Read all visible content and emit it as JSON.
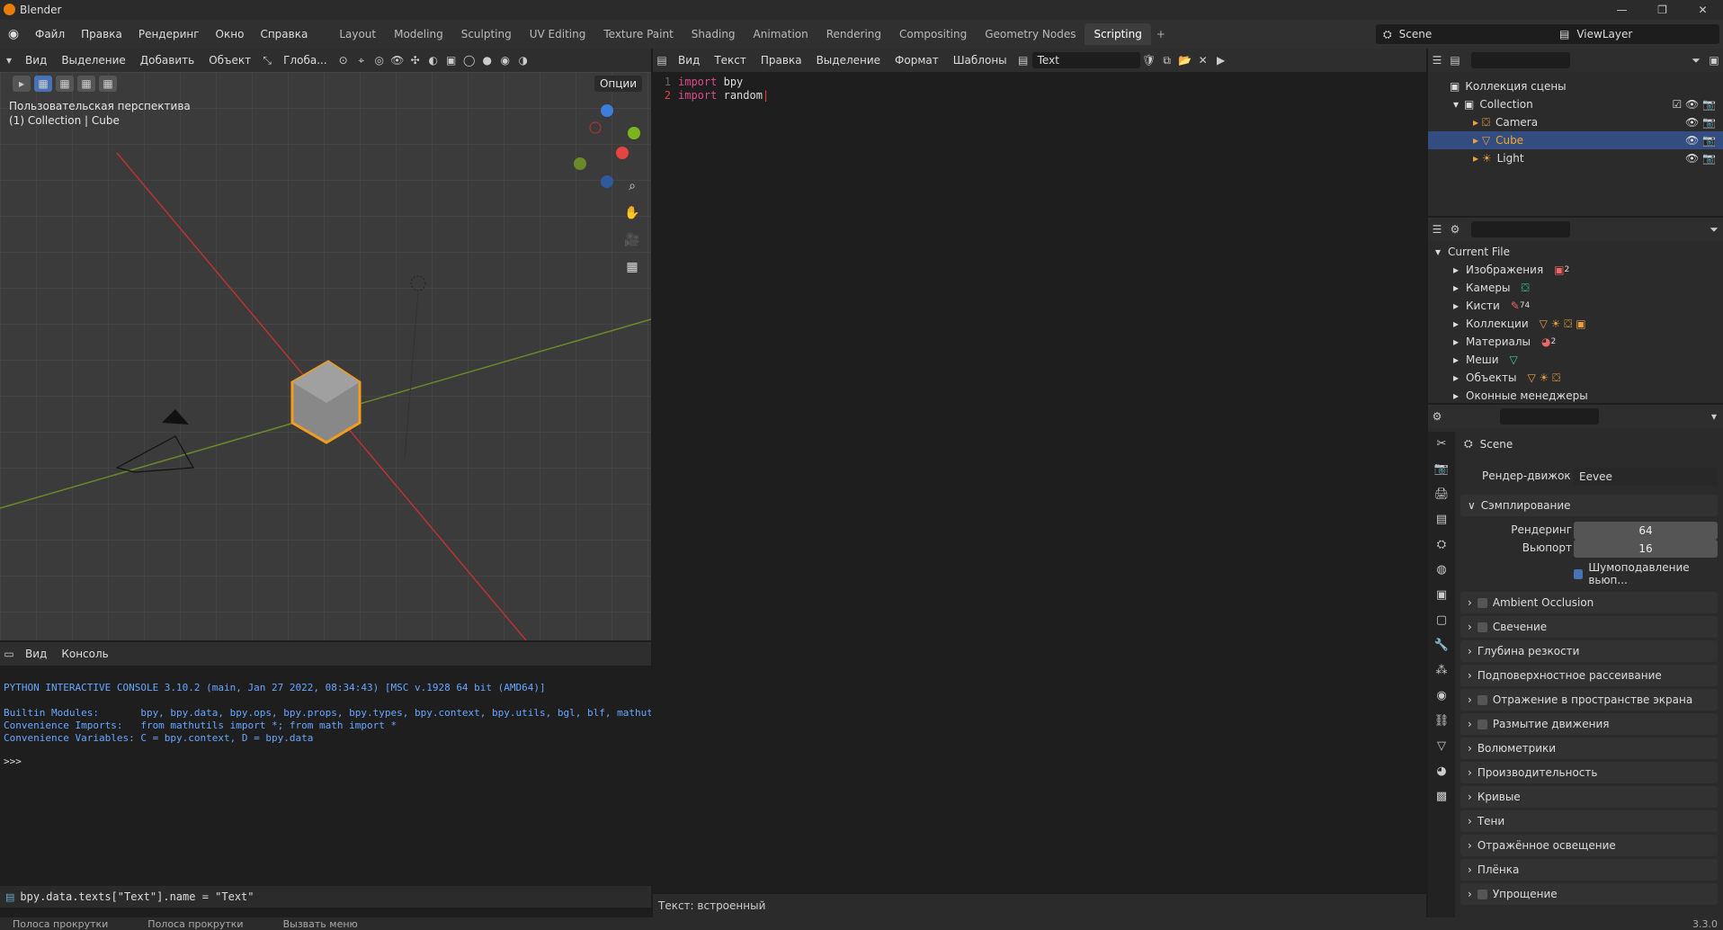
{
  "window": {
    "title": "Blender"
  },
  "menu": [
    "Файл",
    "Правка",
    "Рендеринг",
    "Окно",
    "Справка"
  ],
  "workspaces": [
    "Layout",
    "Modeling",
    "Sculpting",
    "UV Editing",
    "Texture Paint",
    "Shading",
    "Animation",
    "Rendering",
    "Compositing",
    "Geometry Nodes",
    "Scripting"
  ],
  "active_workspace": "Scripting",
  "scene": {
    "label": "Scene",
    "viewlayer": "ViewLayer"
  },
  "viewport": {
    "menu": [
      "Вид",
      "Выделение",
      "Добавить",
      "Объект"
    ],
    "orientation": "Глоба...",
    "options": "Опции",
    "perspective": "Пользовательская перспектива",
    "collection": "(1) Collection | Cube"
  },
  "text_editor": {
    "menu": [
      "Вид",
      "Текст",
      "Правка",
      "Выделение",
      "Формат",
      "Шаблоны"
    ],
    "name": "Text",
    "lines": [
      {
        "n": "1",
        "kw": "import",
        "nm": "bpy"
      },
      {
        "n": "2",
        "kw": "import",
        "nm": "random"
      }
    ],
    "status": "Текст: встроенный"
  },
  "console": {
    "menu": [
      "Вид",
      "Консоль"
    ],
    "lines": [
      "PYTHON INTERACTIVE CONSOLE 3.10.2 (main, Jan 27 2022, 08:34:43) [MSC v.1928 64 bit (AMD64)]",
      "",
      "Builtin Modules:       bpy, bpy.data, bpy.ops, bpy.props, bpy.types, bpy.context, bpy.utils, bgl, blf, mathutils",
      "Convenience Imports:   from mathutils import *; from math import *",
      "Convenience Variables: C = bpy.context, D = bpy.data"
    ],
    "prompt": ">>> ",
    "info": "bpy.data.texts[\"Text\"].name = \"Text\""
  },
  "outliner": {
    "root": "Коллекция сцены",
    "collection": "Collection",
    "items": [
      "Camera",
      "Cube",
      "Light"
    ],
    "selected": "Cube"
  },
  "data_browser": {
    "root": "Current File",
    "items": [
      "Изображения",
      "Камеры",
      "Кисти",
      "Коллекции",
      "Материалы",
      "Меши",
      "Объекты",
      "Оконные менеджеры"
    ],
    "counts": {
      "images": "2",
      "brushes": "74",
      "materials": "2"
    }
  },
  "properties": {
    "scene": "Scene",
    "engine_label": "Рендер-движок",
    "engine": "Eevee",
    "sampling": "Сэмплирование",
    "render_label": "Рендеринг",
    "render_value": "64",
    "viewport_label": "Вьюпорт",
    "viewport_value": "16",
    "denoise": "Шумоподавление вьюп...",
    "panels": [
      "Ambient Occlusion",
      "Свечение",
      "Глубина резкости",
      "Подповерхностное рассеивание",
      "Отражение в пространстве экрана",
      "Размытие движения",
      "Волюметрики",
      "Производительность",
      "Кривые",
      "Тени",
      "Отражённое освещение",
      "Плёнка",
      "Упрощение"
    ],
    "version": "3.3.0"
  },
  "statusbar": [
    "Полоса прокрутки",
    "Полоса прокрутки",
    "Вызвать меню"
  ]
}
